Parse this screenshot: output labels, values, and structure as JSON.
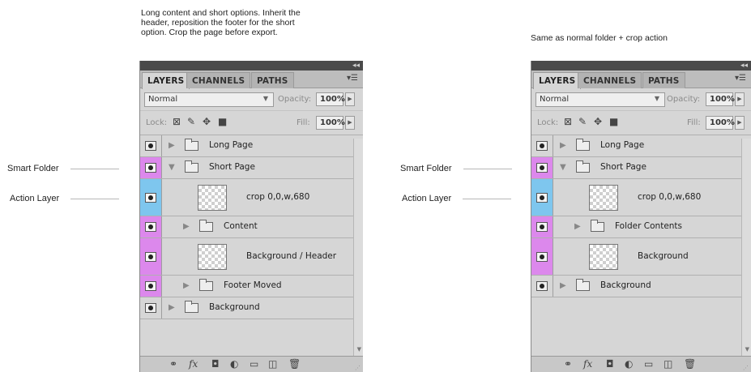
{
  "captions": {
    "left": [
      "Long content and short options. Inherit the",
      "header, reposition the footer for the short",
      "option. Crop the page before export."
    ],
    "right": "Same as normal folder + crop action"
  },
  "callouts": {
    "smart_folder": "Smart Folder",
    "action_layer": "Action Layer"
  },
  "panel": {
    "tabs": [
      "LAYERS",
      "CHANNELS",
      "PATHS"
    ],
    "blend_mode": "Normal",
    "opacity_label": "Opacity:",
    "opacity_value": "100%",
    "lock_label": "Lock:",
    "fill_label": "Fill:",
    "fill_value": "100%"
  },
  "icons": {
    "collapse": "double-chevron-left-icon",
    "panel_menu": "panel-menu-icon",
    "eye": "eye-icon",
    "folder": "folder-icon",
    "bottom_bar": [
      "link-icon",
      "fx-icon",
      "mask-icon",
      "adjustment-icon",
      "new-group-icon",
      "new-layer-icon",
      "trash-icon"
    ]
  },
  "colors": {
    "smart_folder_highlight": "#dc88ec",
    "action_layer_highlight": "#7ec6ee"
  },
  "left_panel": {
    "layers": [
      {
        "name": "Long Page",
        "type": "folder",
        "expanded": false,
        "indent": 0,
        "highlight": "none"
      },
      {
        "name": "Short Page",
        "type": "folder",
        "expanded": true,
        "indent": 0,
        "highlight": "smart"
      },
      {
        "name": "crop 0,0,w,680",
        "type": "thumb",
        "indent": 1,
        "highlight": "action"
      },
      {
        "name": "Content",
        "type": "folder",
        "expanded": false,
        "indent": 1,
        "highlight": "smart"
      },
      {
        "name": "Background / Header",
        "type": "thumb",
        "indent": 1,
        "highlight": "smart"
      },
      {
        "name": "Footer Moved",
        "type": "folder",
        "expanded": false,
        "indent": 1,
        "highlight": "smart"
      },
      {
        "name": "Background",
        "type": "folder",
        "expanded": false,
        "indent": 0,
        "highlight": "none"
      }
    ]
  },
  "right_panel": {
    "layers": [
      {
        "name": "Long Page",
        "type": "folder",
        "expanded": false,
        "indent": 0,
        "highlight": "none"
      },
      {
        "name": "Short Page",
        "type": "folder",
        "expanded": true,
        "indent": 0,
        "highlight": "smart"
      },
      {
        "name": "crop 0,0,w,680",
        "type": "thumb",
        "indent": 1,
        "highlight": "action"
      },
      {
        "name": "Folder Contents",
        "type": "folder",
        "expanded": false,
        "indent": 1,
        "highlight": "smart"
      },
      {
        "name": "Background",
        "type": "thumb",
        "indent": 1,
        "highlight": "smart"
      },
      {
        "name": "Background",
        "type": "folder",
        "expanded": false,
        "indent": 0,
        "highlight": "none"
      }
    ]
  }
}
